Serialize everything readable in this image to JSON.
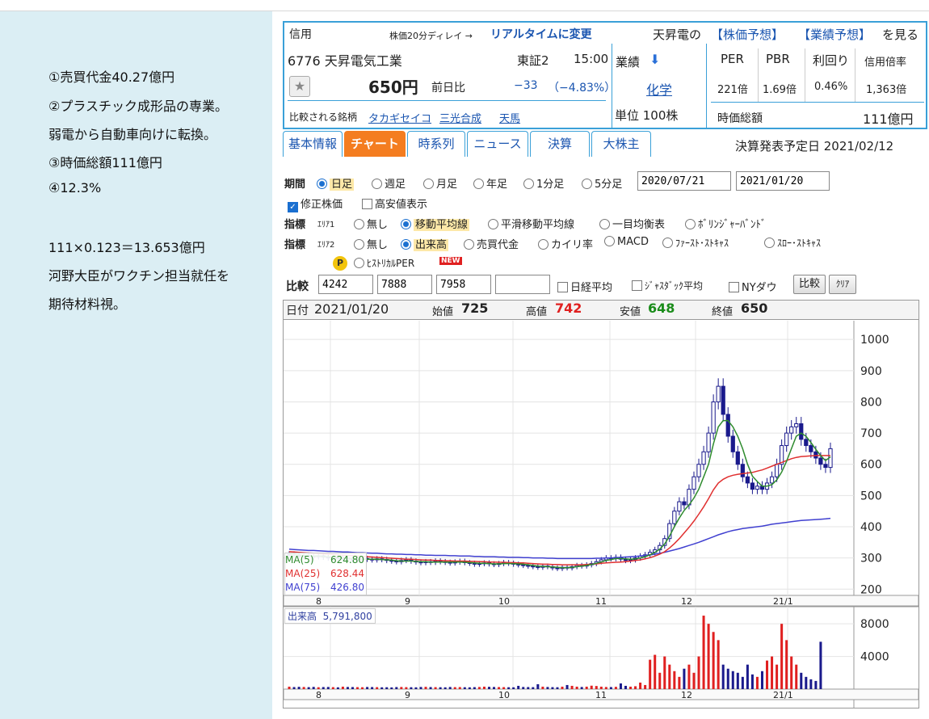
{
  "memo": {
    "lines": [
      "①売買代金40.27億円",
      "②プラスチック成形品の専業。",
      "弱電から自動車向けに転換。",
      "③時価総額111億円",
      "④12.3%",
      "",
      "111×0.123＝13.653億円",
      "河野大臣がワクチン担当就任を",
      "期待材料視。"
    ]
  },
  "quote": {
    "shinyo": "信用",
    "delay": "株価20分ディレイ →",
    "realtime": "リアルタイムに変更",
    "company_short": "天昇電の",
    "yoso_kabuka": "【株価予想】",
    "yoso_gyoseki": "【業績予想】",
    "wo_miru": "を見る",
    "code_name": "6776 天昇電気工業",
    "market": "東証2",
    "time": "15:00",
    "price": "650円",
    "zenjitsu": "前日比",
    "change": "−33",
    "change_pct": "（−4.83%）",
    "compare_label": "比較される銘柄",
    "compare": [
      "タカギセイコ",
      "三光合成",
      "天馬"
    ],
    "gyoseki": "業績",
    "sector": "化学",
    "unit": "単位 100株",
    "metric_heads": [
      "PER",
      "PBR",
      "利回り",
      "信用倍率"
    ],
    "metric_vals": [
      "221倍",
      "1.69倍",
      "0.46%",
      "1,363倍"
    ],
    "mcap_label": "時価総額",
    "mcap": "111億円"
  },
  "tabs": [
    "基本情報",
    "チャート",
    "時系列",
    "ニュース",
    "決算",
    "大株主"
  ],
  "kessan": "決算発表予定日 2021/02/12",
  "form": {
    "kikan": "期間",
    "periods": [
      "日足",
      "週足",
      "月足",
      "年足",
      "1分足",
      "5分足"
    ],
    "date_from": "2020/07/21",
    "date_to": "2021/01/20",
    "shusei": "修正株価",
    "takayasu": "高安値表示",
    "shihyo": "指標",
    "area1": "ｴﾘｱ1",
    "area2": "ｴﾘｱ2",
    "a1": [
      "無し",
      "移動平均線",
      "平滑移動平均線",
      "一目均衡表",
      "ﾎﾞﾘﾝｼﾞｬｰﾊﾞﾝﾄﾞ"
    ],
    "a2": [
      "無し",
      "出来高",
      "売買代金",
      "カイリ率",
      "MACD",
      "ﾌｧｰｽﾄ･ｽﾄｷｬｽ",
      "ｽﾛｰ･ｽﾄｷｬｽ"
    ],
    "per": "ﾋｽﾄﾘｶﾙPER",
    "new": "NEW",
    "hikaku": "比較",
    "codes": [
      "4242",
      "7888",
      "7958",
      ""
    ],
    "nikkei": "日経平均",
    "jasdaq": "ｼﾞｬｽﾀﾞｯｸ平均",
    "nydow": "NYダウ",
    "btn_hikaku": "比較",
    "btn_clear": "ｸﾘｱ"
  },
  "ohlc_bar": {
    "date_label": "日付",
    "date": "2021/01/20",
    "open_label": "始値",
    "open": "725",
    "high_label": "高値",
    "high": "742",
    "low_label": "安値",
    "low": "648",
    "close_label": "終値",
    "close": "650"
  },
  "ma_legend": [
    {
      "name": "MA(5)",
      "value": "624.80",
      "color": "#2e8b2e"
    },
    {
      "name": "MA(25)",
      "value": "628.44",
      "color": "#e03030"
    },
    {
      "name": "MA(75)",
      "value": "426.80",
      "color": "#4040d0"
    }
  ],
  "volume_label": "出来高",
  "volume_value": "5,791,800",
  "colors": {
    "up": "#ffffff",
    "down": "#1a1a8c",
    "vol_up": "#e02020",
    "vol_down": "#1a1a8c",
    "ma5": "#2e8b2e",
    "ma25": "#e03030",
    "ma75": "#4040d0"
  },
  "chart_data": {
    "type": "line",
    "x_ticks": [
      "8",
      "9",
      "10",
      "11",
      "12",
      "21/1"
    ],
    "y_ticks": [
      200,
      300,
      400,
      500,
      600,
      700,
      800,
      900,
      1000
    ],
    "ylim": [
      180,
      1060
    ],
    "vol_ticks": [
      4000,
      8000
    ],
    "vol_ylim": [
      0,
      9500
    ],
    "candles_close": [
      312,
      310,
      305,
      308,
      306,
      304,
      307,
      303,
      300,
      302,
      298,
      300,
      296,
      294,
      295,
      298,
      296,
      294,
      297,
      295,
      292,
      290,
      288,
      292,
      294,
      290,
      287,
      285,
      288,
      286,
      290,
      288,
      286,
      284,
      287,
      289,
      285,
      283,
      280,
      282,
      284,
      281,
      279,
      282,
      285,
      283,
      280,
      278,
      276,
      274,
      272,
      270,
      274,
      272,
      268,
      266,
      270,
      268,
      272,
      276,
      274,
      278,
      282,
      288,
      294,
      300,
      298,
      302,
      296,
      292,
      294,
      300,
      306,
      310,
      318,
      326,
      340,
      362,
      410,
      450,
      480,
      470,
      520,
      560,
      600,
      640,
      700,
      800,
      850,
      760,
      690,
      640,
      600,
      560,
      540,
      520,
      530,
      520,
      540,
      560,
      600,
      660,
      700,
      720,
      730,
      680,
      660,
      640,
      620,
      600,
      590,
      650
    ],
    "volume": [
      300,
      250,
      280,
      260,
      240,
      270,
      230,
      250,
      260,
      240,
      220,
      300,
      260,
      250,
      240,
      230,
      260,
      250,
      240,
      220,
      230,
      210,
      250,
      260,
      240,
      230,
      220,
      260,
      280,
      250,
      240,
      230,
      220,
      260,
      240,
      250,
      230,
      220,
      240,
      260,
      300,
      280,
      260,
      250,
      240,
      230,
      220,
      400,
      260,
      250,
      240,
      600,
      300,
      260,
      240,
      230,
      300,
      500,
      400,
      300,
      260,
      300,
      420,
      380,
      300,
      260,
      250,
      280,
      700,
      400,
      300,
      350,
      800,
      500,
      3600,
      4200,
      2000,
      4000,
      3000,
      2200,
      1500,
      2500,
      3000,
      2000,
      4000,
      9000,
      8000,
      7000,
      6000,
      3000,
      2500,
      2200,
      2000,
      1500,
      3000,
      1800,
      1500,
      2200,
      3500,
      4000,
      3000,
      8000,
      6000,
      4000,
      3000,
      2000,
      1500,
      1200,
      1000,
      5800
    ],
    "ma5": [
      312,
      311,
      309,
      308,
      306,
      306,
      306,
      305,
      304,
      303,
      302,
      301,
      299,
      298,
      297,
      297,
      296,
      296,
      296,
      295,
      294,
      293,
      291,
      290,
      290,
      290,
      289,
      288,
      288,
      287,
      287,
      287,
      287,
      287,
      287,
      287,
      286,
      285,
      284,
      283,
      283,
      282,
      281,
      281,
      282,
      282,
      282,
      281,
      280,
      278,
      276,
      274,
      273,
      272,
      271,
      270,
      269,
      269,
      270,
      272,
      274,
      276,
      279,
      283,
      287,
      292,
      295,
      298,
      298,
      297,
      296,
      297,
      300,
      304,
      310,
      318,
      328,
      345,
      370,
      400,
      428,
      452,
      470,
      492,
      520,
      560,
      600,
      665,
      720,
      740,
      740,
      720,
      690,
      650,
      600,
      562,
      545,
      530,
      530,
      535,
      550,
      575,
      610,
      650,
      690,
      700,
      690,
      670,
      648,
      628,
      612,
      624
    ],
    "ma25": [
      320,
      319,
      318,
      317,
      316,
      315,
      314,
      313,
      312,
      311,
      310,
      309,
      308,
      307,
      306,
      305,
      304,
      303,
      302,
      301,
      300,
      299,
      298,
      297,
      296,
      296,
      295,
      294,
      293,
      293,
      292,
      292,
      291,
      291,
      290,
      290,
      290,
      289,
      289,
      288,
      288,
      287,
      287,
      286,
      286,
      285,
      285,
      284,
      284,
      283,
      282,
      281,
      280,
      280,
      279,
      279,
      278,
      278,
      278,
      278,
      278,
      279,
      280,
      281,
      283,
      284,
      285,
      286,
      287,
      288,
      290,
      292,
      294,
      297,
      301,
      306,
      312,
      320,
      332,
      346,
      362,
      380,
      398,
      418,
      440,
      464,
      490,
      518,
      540,
      552,
      560,
      565,
      568,
      570,
      572,
      574,
      578,
      582,
      588,
      594,
      600,
      606,
      612,
      618,
      622,
      625,
      626,
      627,
      628,
      628,
      628,
      628
    ],
    "ma75": [
      328,
      327,
      326,
      325,
      324,
      324,
      323,
      322,
      321,
      321,
      320,
      319,
      319,
      318,
      317,
      317,
      316,
      315,
      315,
      314,
      313,
      313,
      312,
      312,
      311,
      311,
      310,
      310,
      309,
      309,
      308,
      308,
      308,
      307,
      307,
      306,
      306,
      306,
      305,
      305,
      304,
      304,
      304,
      303,
      303,
      302,
      302,
      302,
      301,
      301,
      300,
      300,
      300,
      299,
      299,
      298,
      298,
      298,
      298,
      298,
      298,
      298,
      298,
      299,
      299,
      300,
      300,
      301,
      302,
      303,
      304,
      305,
      306,
      308,
      310,
      312,
      315,
      318,
      322,
      326,
      330,
      335,
      340,
      345,
      350,
      356,
      362,
      368,
      374,
      379,
      384,
      388,
      391,
      394,
      396,
      398,
      400,
      402,
      405,
      408,
      410,
      412,
      414,
      416,
      418,
      420,
      421,
      422,
      423,
      424,
      425,
      427
    ]
  }
}
